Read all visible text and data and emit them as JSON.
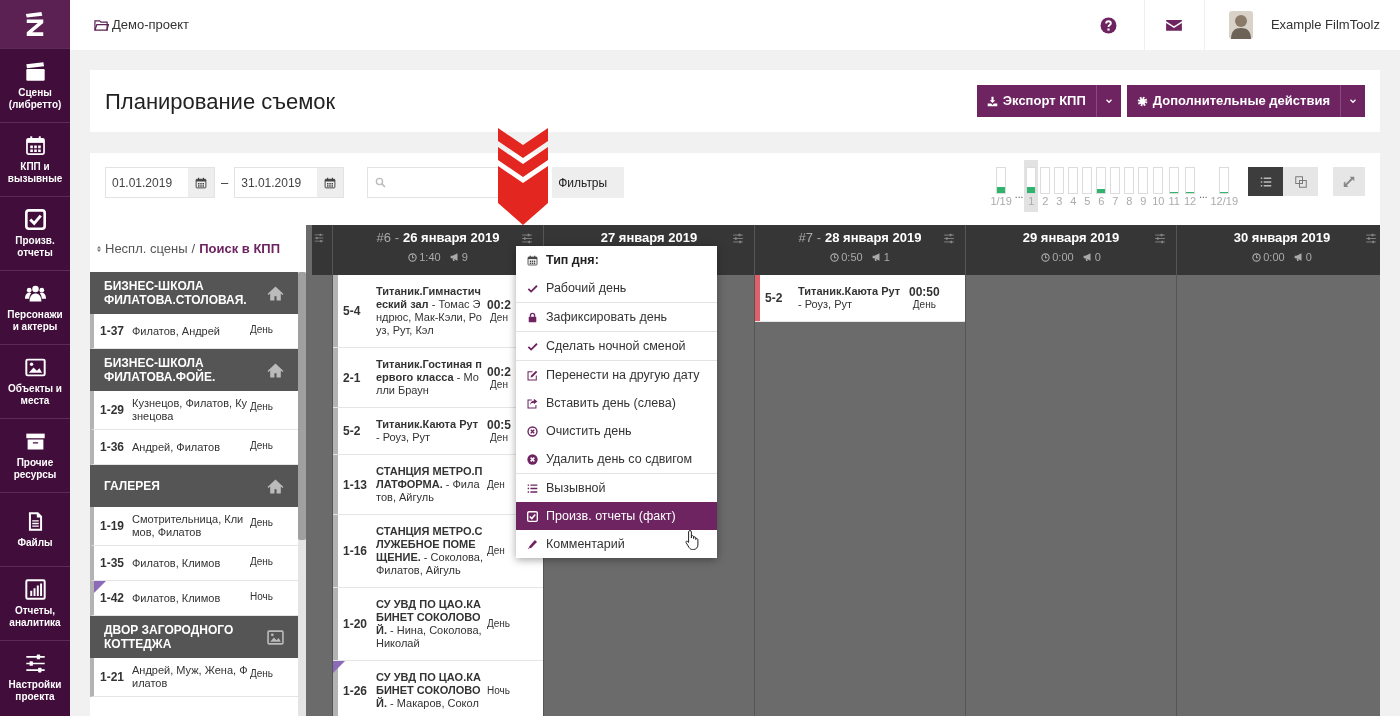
{
  "sidebar": {
    "items": [
      {
        "label": "Сцены (либретто)"
      },
      {
        "label": "КПП и вызывные"
      },
      {
        "label": "Произв. отчеты"
      },
      {
        "label": "Персонажи и актеры"
      },
      {
        "label": "Объекты и места"
      },
      {
        "label": "Прочие ресурсы"
      },
      {
        "label": "Файлы"
      },
      {
        "label": "Отчеты, аналитика"
      },
      {
        "label": "Настройки проекта"
      }
    ]
  },
  "breadcrumb": "Демо-проект",
  "user": {
    "name": "Example FilmToolz"
  },
  "page_title": "Планирование съемок",
  "actions": [
    {
      "label": "Экспорт КПП"
    },
    {
      "label": "Дополнительные действия"
    }
  ],
  "date_range": {
    "from": "01.01.2019",
    "separator": "–",
    "to": "31.01.2019"
  },
  "filters_button": "Фильтры",
  "weeks": [
    {
      "kind": "bar",
      "label": "1/19",
      "level": 0.25,
      "selected": false
    },
    {
      "kind": "ellipsis",
      "label": "..."
    },
    {
      "kind": "bar",
      "label": "1",
      "level": 0.25,
      "selected": true
    },
    {
      "kind": "bar",
      "label": "2",
      "level": 0,
      "selected": false
    },
    {
      "kind": "bar",
      "label": "3",
      "level": 0,
      "selected": false
    },
    {
      "kind": "bar",
      "label": "4",
      "level": 0,
      "selected": false
    },
    {
      "kind": "bar",
      "label": "5",
      "level": 0,
      "selected": false
    },
    {
      "kind": "bar",
      "label": "6",
      "level": 0.15,
      "selected": false
    },
    {
      "kind": "bar",
      "label": "7",
      "level": 0,
      "selected": false
    },
    {
      "kind": "bar",
      "label": "8",
      "level": 0,
      "selected": false
    },
    {
      "kind": "bar",
      "label": "9",
      "level": 0,
      "selected": false
    },
    {
      "kind": "bar",
      "label": "10",
      "level": 0,
      "selected": false
    },
    {
      "kind": "bar",
      "label": "11",
      "level": 0.04,
      "selected": false
    },
    {
      "kind": "bar",
      "label": "12",
      "level": 0.04,
      "selected": false
    },
    {
      "kind": "ellipsis",
      "label": "..."
    },
    {
      "kind": "bar",
      "label": "12/19",
      "level": 0.04,
      "selected": false
    }
  ],
  "view_toggle": [
    {
      "kind": "list",
      "selected": true
    },
    {
      "kind": "copy",
      "selected": false
    }
  ],
  "unscheduled": {
    "title": "Неспл. сцены",
    "separator": "/",
    "link": "Поиск в КПП",
    "groups": [
      {
        "name": "БИЗНЕС-ШКОЛА ФИЛАТОВА.СТОЛОВАЯ.",
        "kind": "house",
        "scenes": [
          {
            "id": "1-37",
            "cast": "Филатов, Андрей",
            "shift": "День",
            "night": false
          }
        ]
      },
      {
        "name": "БИЗНЕС-ШКОЛА ФИЛАТОВА.ФОЙЕ.",
        "kind": "house",
        "scenes": [
          {
            "id": "1-29",
            "cast": "Кузнецов, Филатов, Кузнецова",
            "shift": "День",
            "night": false
          },
          {
            "id": "1-36",
            "cast": "Андрей, Филатов",
            "shift": "День",
            "night": false
          }
        ]
      },
      {
        "name": "ГАЛЕРЕЯ",
        "kind": "house",
        "scenes": [
          {
            "id": "1-19",
            "cast": "Смотрительница, Климов, Филатов",
            "shift": "День",
            "night": false
          },
          {
            "id": "1-35",
            "cast": "Филатов, Климов",
            "shift": "День",
            "night": false
          },
          {
            "id": "1-42",
            "cast": "Филатов, Климов",
            "shift": "Ночь",
            "night": true
          }
        ]
      },
      {
        "name": "ДВОР ЗАГОРОДНОГО КОТТЕДЖА",
        "kind": "picture",
        "scenes": [
          {
            "id": "1-21",
            "cast": "Андрей, Муж, Жена, Филатов",
            "shift": "День",
            "night": false
          }
        ]
      }
    ]
  },
  "days": [
    {
      "prefix": "#6 -",
      "date": "26 января 2019",
      "time": "1:40",
      "calls": "9",
      "scenes": [
        {
          "id": "5-4",
          "text": "**Титаник.Гимнастический зал** - Томас Эндрюс, Мак-Кэли, Роуз, Рут, Кэл",
          "time": "00:2",
          "shift": "Ден",
          "night": false,
          "color": "#b3b3b3"
        },
        {
          "id": "2-1",
          "text": "**Титаник.Гостиная первого класса** - Молли Браун",
          "time": "00:2",
          "shift": "Ден",
          "night": false,
          "color": "#b3b3b3"
        },
        {
          "id": "5-2",
          "text": "**Титаник.Каюта Рут** - Роуз, Рут",
          "time": "00:5",
          "shift": "Ден",
          "night": false,
          "color": "#b3b3b3"
        },
        {
          "id": "1-13",
          "text": "**СТАНЦИЯ МЕТРО.ПЛАТФОРМА.** - Филатов, Айгуль",
          "shift": "Ден",
          "night": false,
          "color": "#b3b3b3"
        },
        {
          "id": "1-16",
          "text": "**СТАНЦИЯ МЕТРО.СЛУЖЕБНОЕ ПОМЕЩЕНИЕ.** - Соколова, Филатов, Айгуль",
          "shift": "Ден",
          "night": false,
          "color": "#b3b3b3"
        },
        {
          "id": "1-20",
          "text": "**СУ УВД ПО ЦАО.КАБИНЕТ СОКОЛОВОЙ.** - Нина, Соколова, Николай",
          "shift": "День",
          "night": false,
          "color": "#b3b3b3"
        },
        {
          "id": "1-26",
          "text": "**СУ УВД ПО ЦАО.КАБИНЕТ СОКОЛОВОЙ.** - Макаров, Сокол",
          "shift": "Ночь",
          "night": true,
          "color": "#b3b3b3"
        }
      ]
    },
    {
      "date": "27 января 2019"
    },
    {
      "prefix": "#7 -",
      "date": "28 января 2019",
      "time": "0:50",
      "calls": "1",
      "scenes": [
        {
          "id": "5-2",
          "text": "**Титаник.Каюта Рут** - Роуз, Рут",
          "time": "00:50",
          "shift": "День",
          "night": false,
          "color": "#e0606a"
        }
      ]
    },
    {
      "date": "29 января 2019",
      "time": "0:00",
      "calls": "0"
    },
    {
      "date": "30 января 2019",
      "time": "0:00",
      "calls": "0"
    }
  ],
  "context_menu": {
    "sections": [
      [
        {
          "kind": "header",
          "label": "Тип дня:"
        },
        {
          "kind": "action",
          "label": "Рабочий день",
          "selected": false
        }
      ],
      [
        {
          "kind": "action",
          "label": "Зафиксировать день",
          "selected": false
        }
      ],
      [
        {
          "kind": "action",
          "label": "Сделать ночной сменой",
          "selected": false
        }
      ],
      [
        {
          "kind": "action",
          "label": "Перенести на другую дату",
          "selected": false
        },
        {
          "kind": "action",
          "label": "Вставить день (слева)",
          "selected": false
        },
        {
          "kind": "action",
          "label": "Очистить день",
          "selected": false
        },
        {
          "kind": "action",
          "label": "Удалить день со сдвигом",
          "selected": false
        }
      ],
      [
        {
          "kind": "action",
          "label": "Вызывной",
          "selected": false
        },
        {
          "kind": "action",
          "label": "Произв. отчеты (факт)",
          "selected": true
        },
        {
          "kind": "action",
          "label": "Комментарий",
          "selected": false
        }
      ]
    ]
  }
}
